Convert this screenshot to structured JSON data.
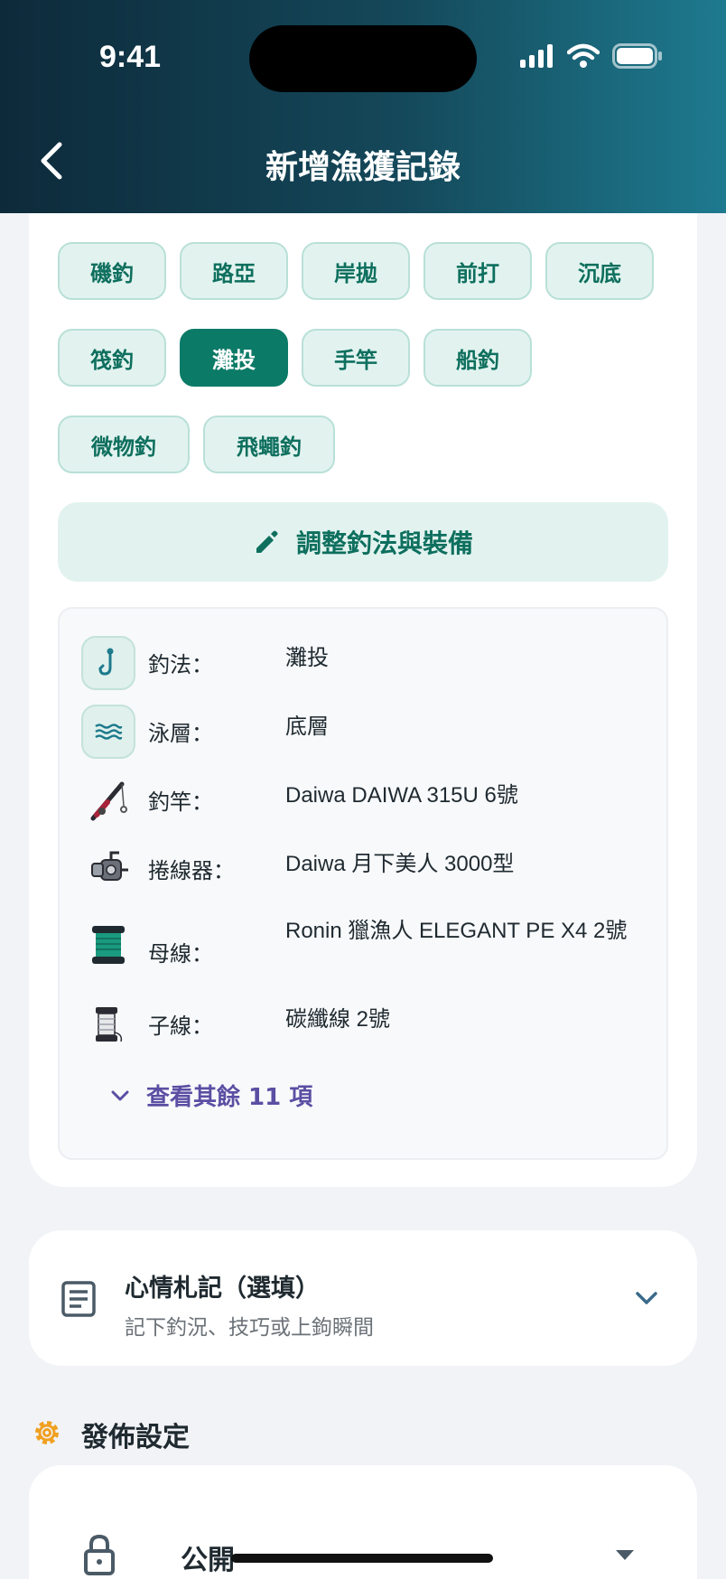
{
  "status_bar": {
    "time": "9:41"
  },
  "header": {
    "title": "新增漁獲記錄"
  },
  "methods": [
    {
      "label": "磯釣",
      "active": false
    },
    {
      "label": "路亞",
      "active": false
    },
    {
      "label": "岸拋",
      "active": false
    },
    {
      "label": "前打",
      "active": false
    },
    {
      "label": "沉底",
      "active": false
    },
    {
      "label": "筏釣",
      "active": false
    },
    {
      "label": "灘投",
      "active": true
    },
    {
      "label": "手竿",
      "active": false
    },
    {
      "label": "船釣",
      "active": false
    },
    {
      "label": "微物釣",
      "active": false
    },
    {
      "label": "飛蠅釣",
      "active": false
    }
  ],
  "adjust_button": {
    "label": "調整釣法與裝備"
  },
  "gear": [
    {
      "label": "釣法：",
      "value": "灘投",
      "icon": "hook-icon"
    },
    {
      "label": "泳層：",
      "value": "底層",
      "icon": "water-layer-icon"
    },
    {
      "label": "釣竿：",
      "value": "Daiwa DAIWA 315U 6號",
      "icon": "fishing-rod-icon"
    },
    {
      "label": "捲線器：",
      "value": "Daiwa 月下美人 3000型",
      "icon": "reel-icon"
    },
    {
      "label": "母線：",
      "value": "Ronin 獵漁人 ELEGANT PE X4 2號",
      "icon": "main-line-spool-icon"
    },
    {
      "label": "子線：",
      "value": "碳纖線 2號",
      "icon": "leader-spool-icon"
    }
  ],
  "show_more": {
    "label": "查看其餘 11 項"
  },
  "notes": {
    "title": "心情札記（選填）",
    "subtitle": "記下釣況、技巧或上鉤瞬間"
  },
  "publish": {
    "section_title": "發佈設定",
    "visibility": "公開"
  },
  "colors": {
    "accent": "#0b7a67",
    "chip_bg": "#e2f3ef",
    "link": "#5b4ea3",
    "gear_orange": "#f0a020"
  }
}
